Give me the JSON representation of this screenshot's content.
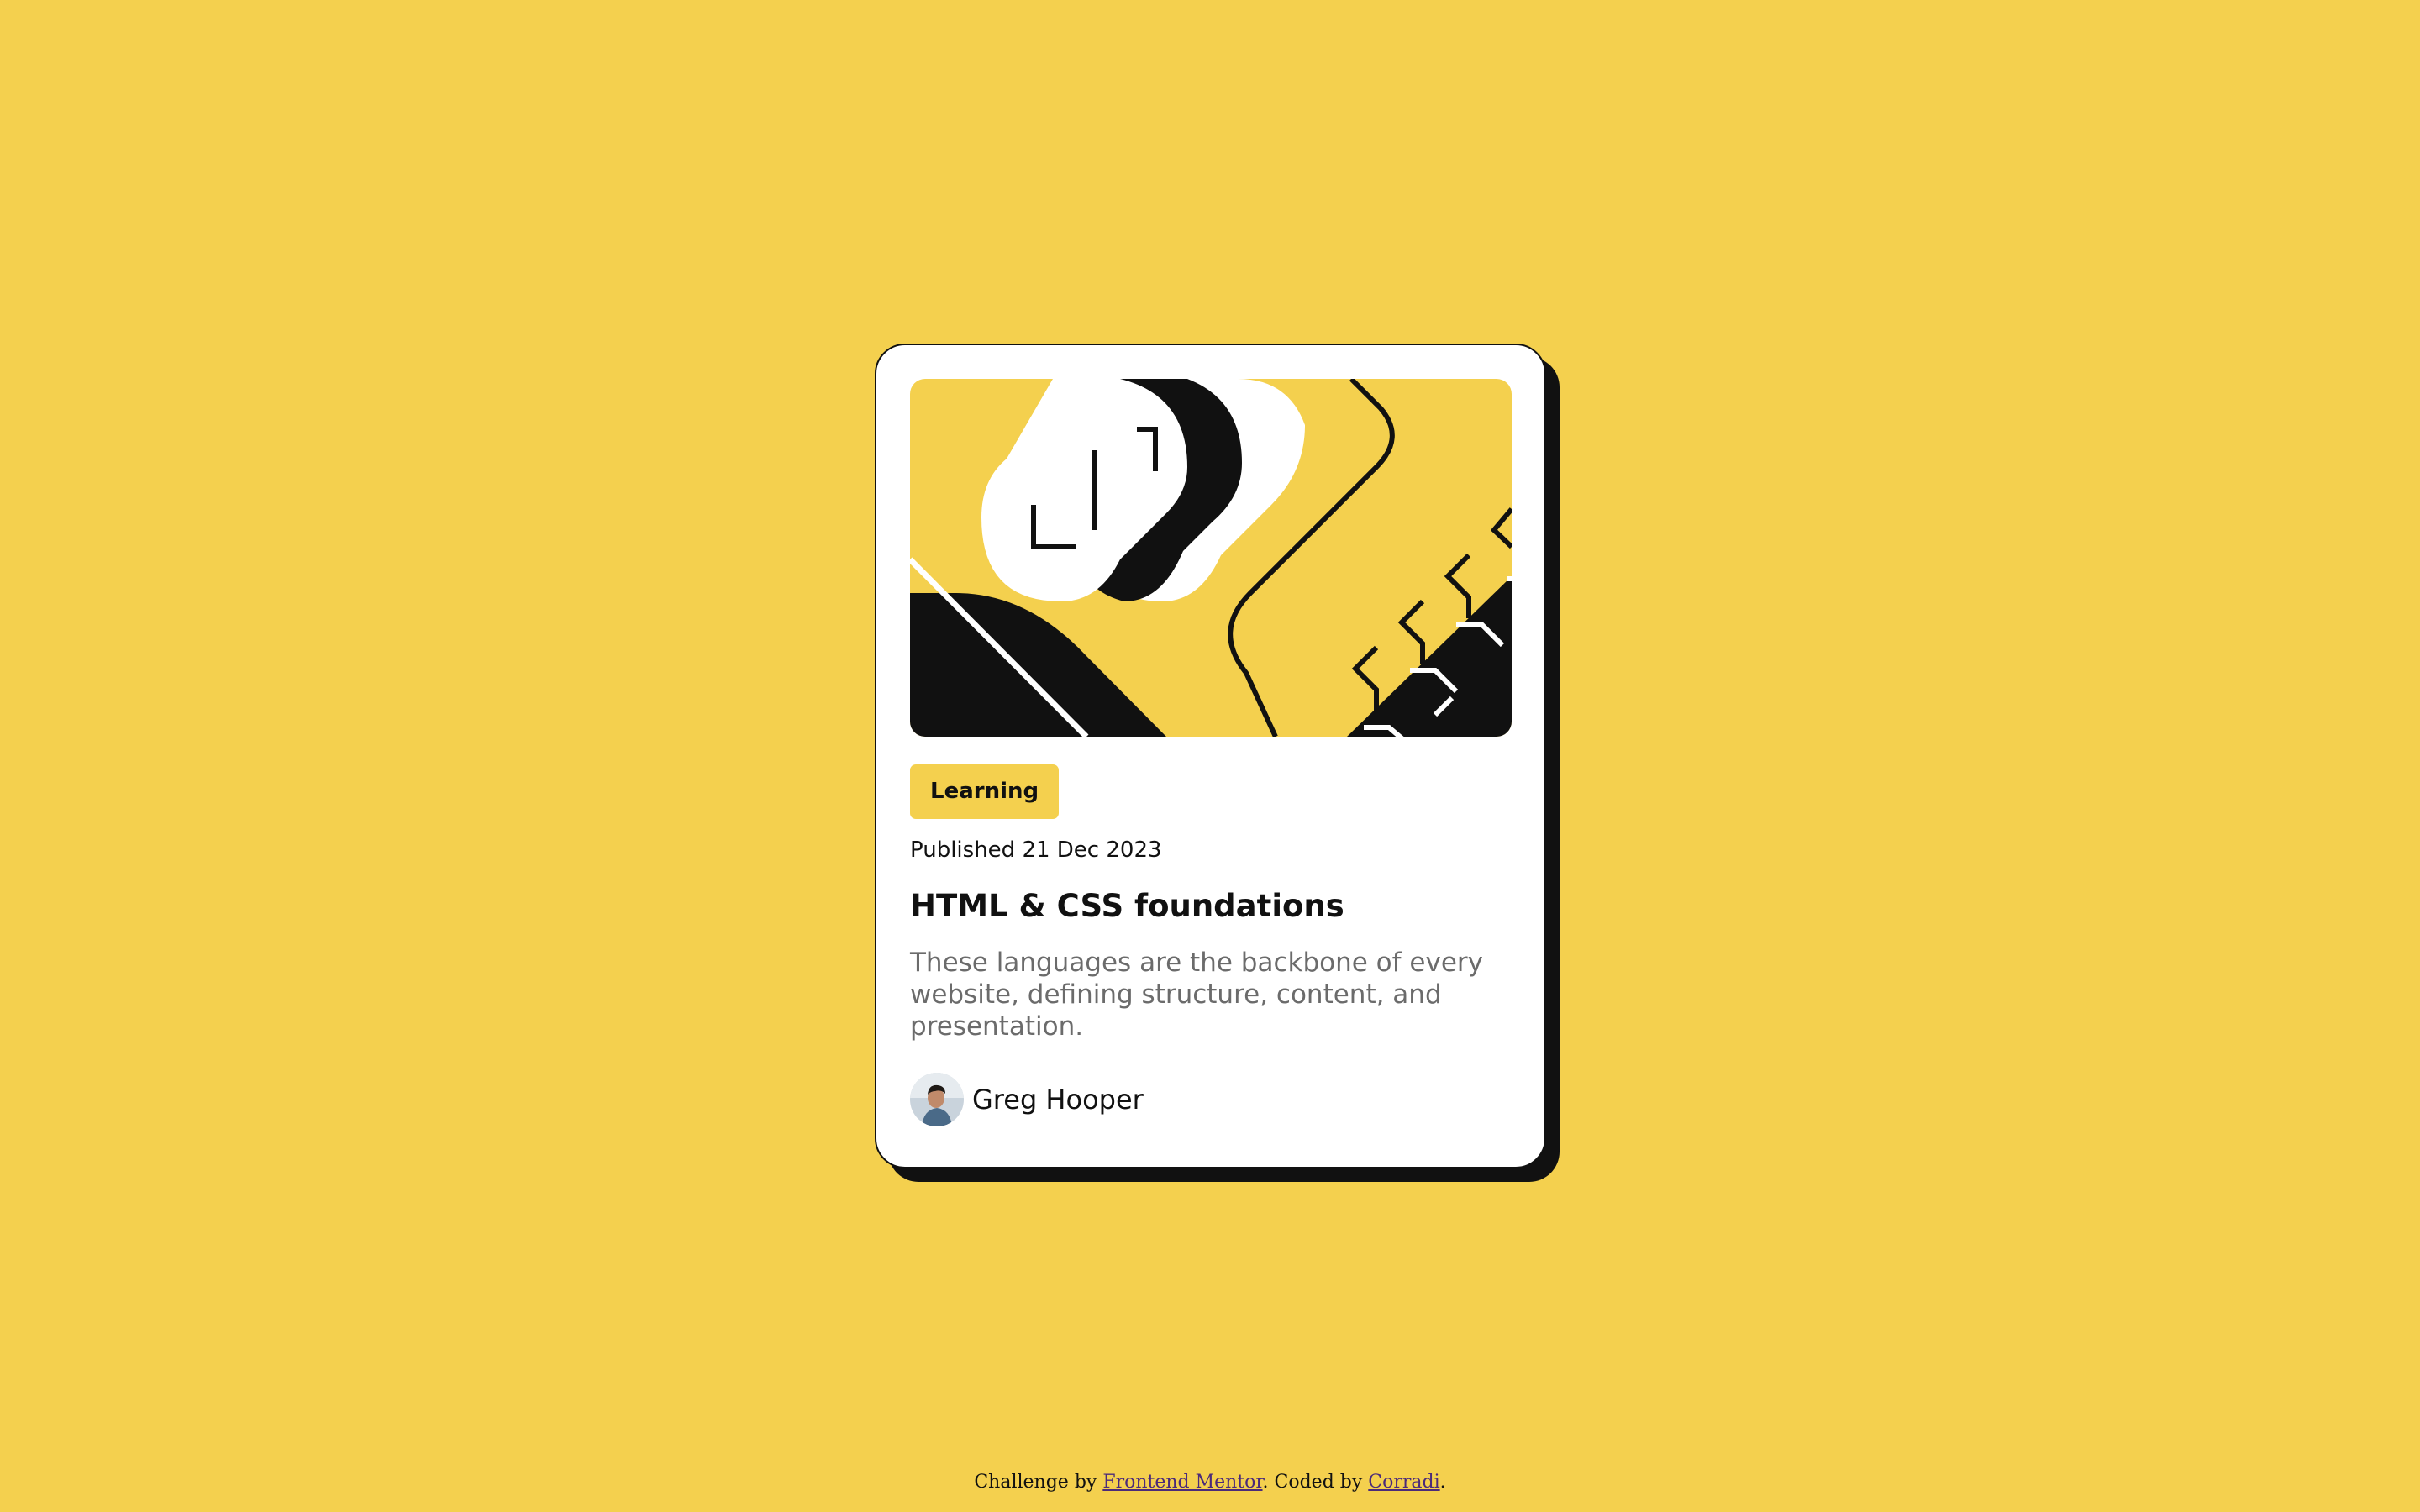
{
  "card": {
    "category": "Learning",
    "published": "Published 21 Dec 2023",
    "title": "HTML & CSS foundations",
    "description": "These languages are the backbone of every website, defining structure, content, and presentation.",
    "author": "Greg Hooper"
  },
  "attribution": {
    "prefix": "Challenge by ",
    "challenge_link": "Frontend Mentor",
    "middle": ". Coded by ",
    "coder_link": "Corradi",
    "suffix": "."
  },
  "colors": {
    "background": "#f4d04e",
    "card": "#ffffff",
    "ink": "#111111",
    "muted": "#6b6b6b",
    "link": "#4b2a7a"
  },
  "icons": {
    "hero": "hero-illustration",
    "avatar": "author-avatar"
  }
}
